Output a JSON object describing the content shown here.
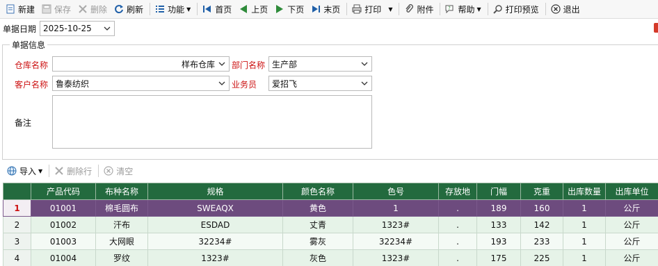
{
  "toolbar": {
    "new": "新建",
    "save": "保存",
    "delete": "删除",
    "refresh": "刷新",
    "function": "功能",
    "first": "首页",
    "prev": "上页",
    "next": "下页",
    "last": "末页",
    "print": "打印",
    "attachment": "附件",
    "help": "帮助",
    "print_preview": "打印预览",
    "exit": "退出"
  },
  "header": {
    "date_label": "单据日期",
    "date_value": "2025-10-25"
  },
  "info": {
    "title": "单据信息",
    "warehouse_label": "仓库名称",
    "warehouse_value": "样布仓库",
    "dept_label": "部门名称",
    "dept_value": "生产部",
    "customer_label": "客户名称",
    "customer_value": "鲁泰纺织",
    "salesman_label": "业务员",
    "salesman_value": "爱招飞",
    "remark_label": "备注",
    "remark_value": ""
  },
  "grid_toolbar": {
    "import": "导入",
    "delete_row": "删除行",
    "clear": "清空"
  },
  "grid": {
    "columns": [
      "",
      "产品代码",
      "布种名称",
      "规格",
      "颜色名称",
      "色号",
      "存放地",
      "门幅",
      "克重",
      "出库数量",
      "出库单位"
    ],
    "rows": [
      [
        "1",
        "01001",
        "棉毛圆布",
        "SWEAQX",
        "黄色",
        "1",
        ".",
        "189",
        "160",
        "1",
        "公斤"
      ],
      [
        "2",
        "01002",
        "汗布",
        "ESDAD",
        "丈青",
        "1323#",
        ".",
        "133",
        "142",
        "1",
        "公斤"
      ],
      [
        "3",
        "01003",
        "大网眼",
        "32234#",
        "雾灰",
        "32234#",
        ".",
        "193",
        "233",
        "1",
        "公斤"
      ],
      [
        "4",
        "01004",
        "罗纹",
        "1323#",
        "灰色",
        "1323#",
        ".",
        "175",
        "225",
        "1",
        "公斤"
      ]
    ]
  },
  "colors": {
    "header_green": "#236a3e",
    "selected_row": "#6d4b7e",
    "required_label": "#cc1111"
  }
}
